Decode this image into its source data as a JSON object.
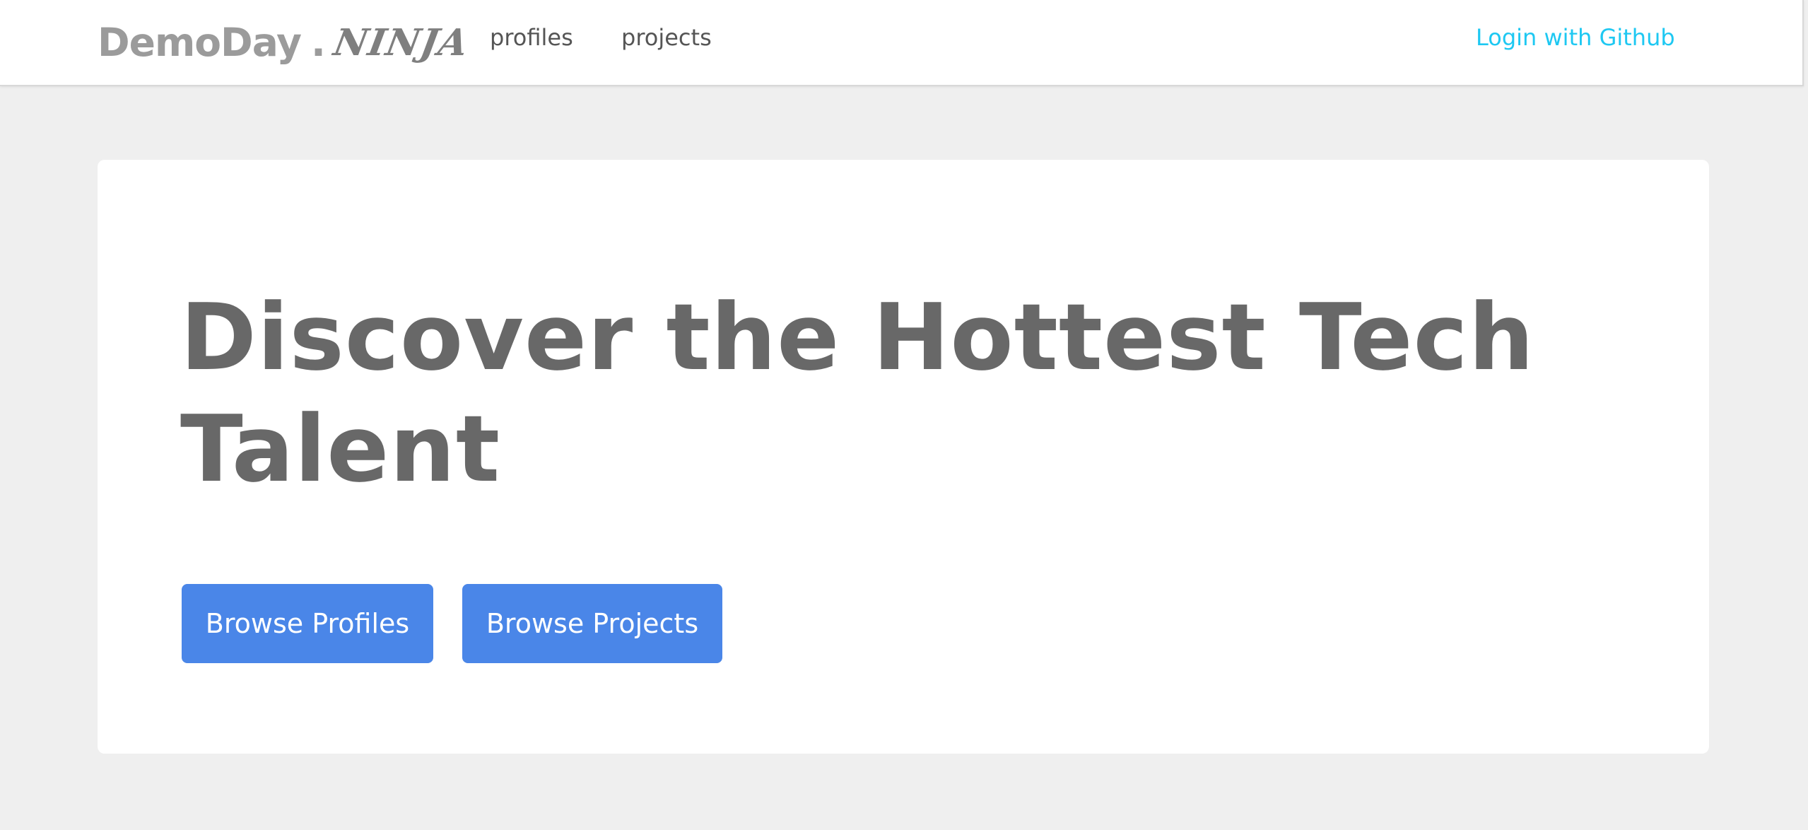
{
  "navbar": {
    "brand": {
      "main": "DemoDay",
      "dot": ".",
      "suffix": "NINJA"
    },
    "links": [
      {
        "label": "profiles"
      },
      {
        "label": "projects"
      }
    ],
    "login_label": "Login with Github"
  },
  "hero": {
    "title": "Discover the Hottest Tech Talent",
    "buttons": [
      {
        "label": "Browse Profiles"
      },
      {
        "label": "Browse Projects"
      }
    ]
  },
  "colors": {
    "page_background": "#efefef",
    "card_background": "#ffffff",
    "brand_text": "#9b9b9b",
    "title_text": "#686868",
    "login_link": "#1ec8f2",
    "button_primary": "#4a86e8"
  }
}
